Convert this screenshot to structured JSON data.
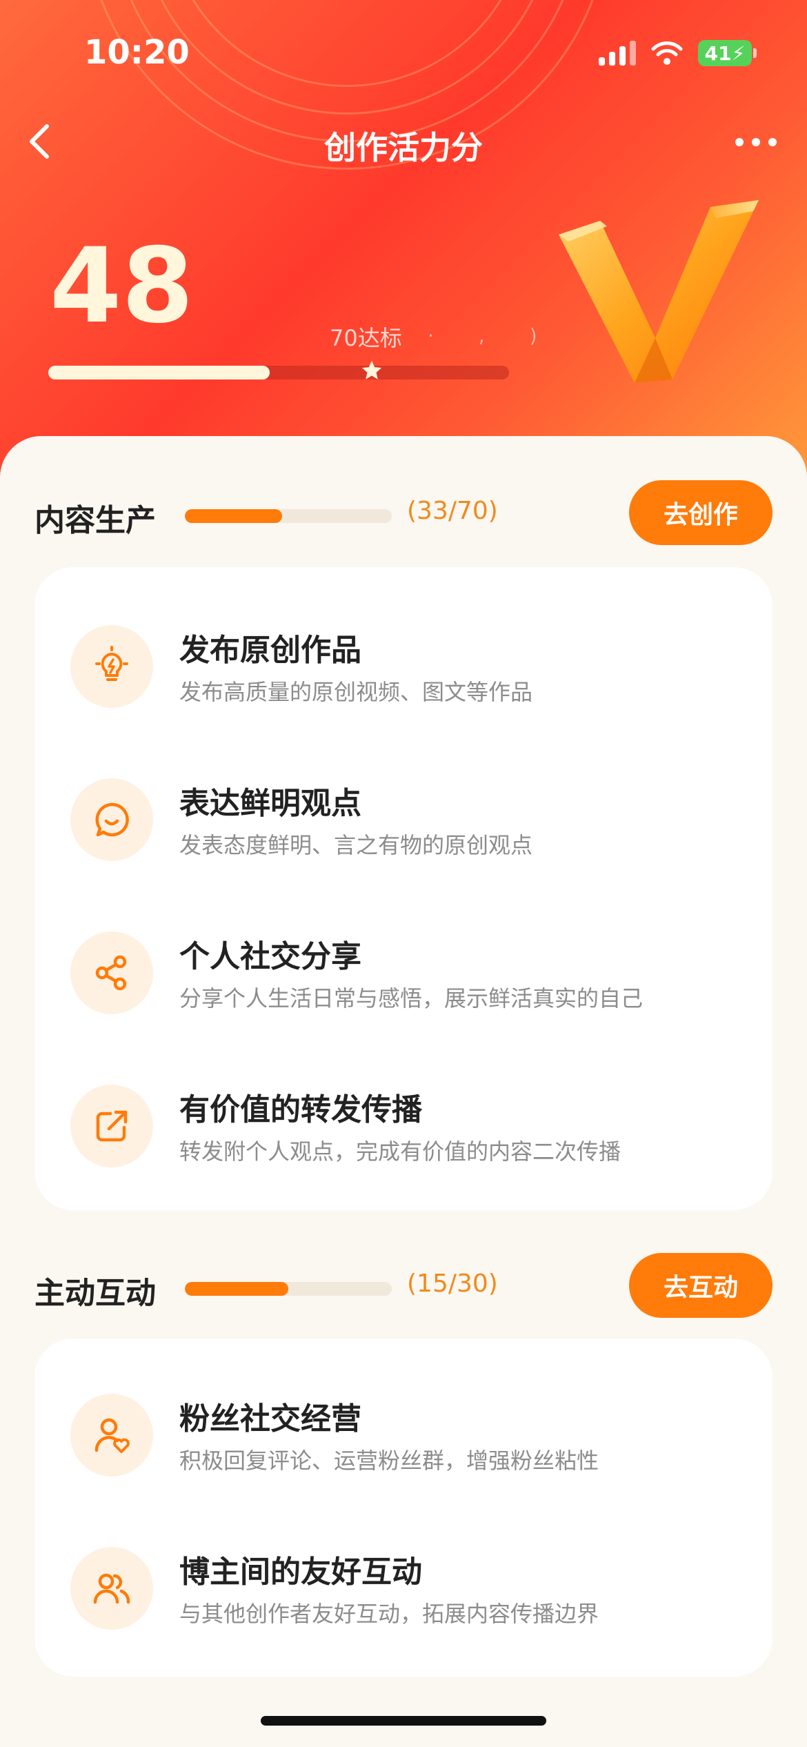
{
  "status_bar": {
    "time": "10:20",
    "battery": "41"
  },
  "header": {
    "title": "创作活力分",
    "back_icon": "chevron-left-icon",
    "more_icon": "more-horizontal-icon"
  },
  "score": {
    "value": "48",
    "target_label": "70达标",
    "target_dots": "· , )",
    "progress_fraction": 0.48,
    "target_fraction": 0.7
  },
  "colors": {
    "accent": "#ff7b0a",
    "hero_start": "#ff6a3d",
    "hero_mid": "#ff3a2c",
    "text_primary": "#222222",
    "text_secondary": "#8c8c8c",
    "icon_bg": "#fff1e2"
  },
  "sections": [
    {
      "title": "内容生产",
      "progress_text": "(33/70)",
      "progress_fraction": 0.47,
      "button_label": "去创作",
      "items": [
        {
          "icon": "lightbulb-icon",
          "title": "发布原创作品",
          "desc": "发布高质量的原创视频、图文等作品"
        },
        {
          "icon": "chat-smile-icon",
          "title": "表达鲜明观点",
          "desc": "发表态度鲜明、言之有物的原创观点"
        },
        {
          "icon": "share-icon",
          "title": "个人社交分享",
          "desc": "分享个人生活日常与感悟，展示鲜活真实的自己"
        },
        {
          "icon": "forward-icon",
          "title": "有价值的转发传播",
          "desc": "转发附个人观点，完成有价值的内容二次传播"
        }
      ]
    },
    {
      "title": "主动互动",
      "progress_text": "(15/30)",
      "progress_fraction": 0.5,
      "button_label": "去互动",
      "items": [
        {
          "icon": "user-heart-icon",
          "title": "粉丝社交经营",
          "desc": "积极回复评论、运营粉丝群，增强粉丝粘性"
        },
        {
          "icon": "users-icon",
          "title": "博主间的友好互动",
          "desc": "与其他创作者友好互动，拓展内容传播边界"
        }
      ]
    }
  ]
}
